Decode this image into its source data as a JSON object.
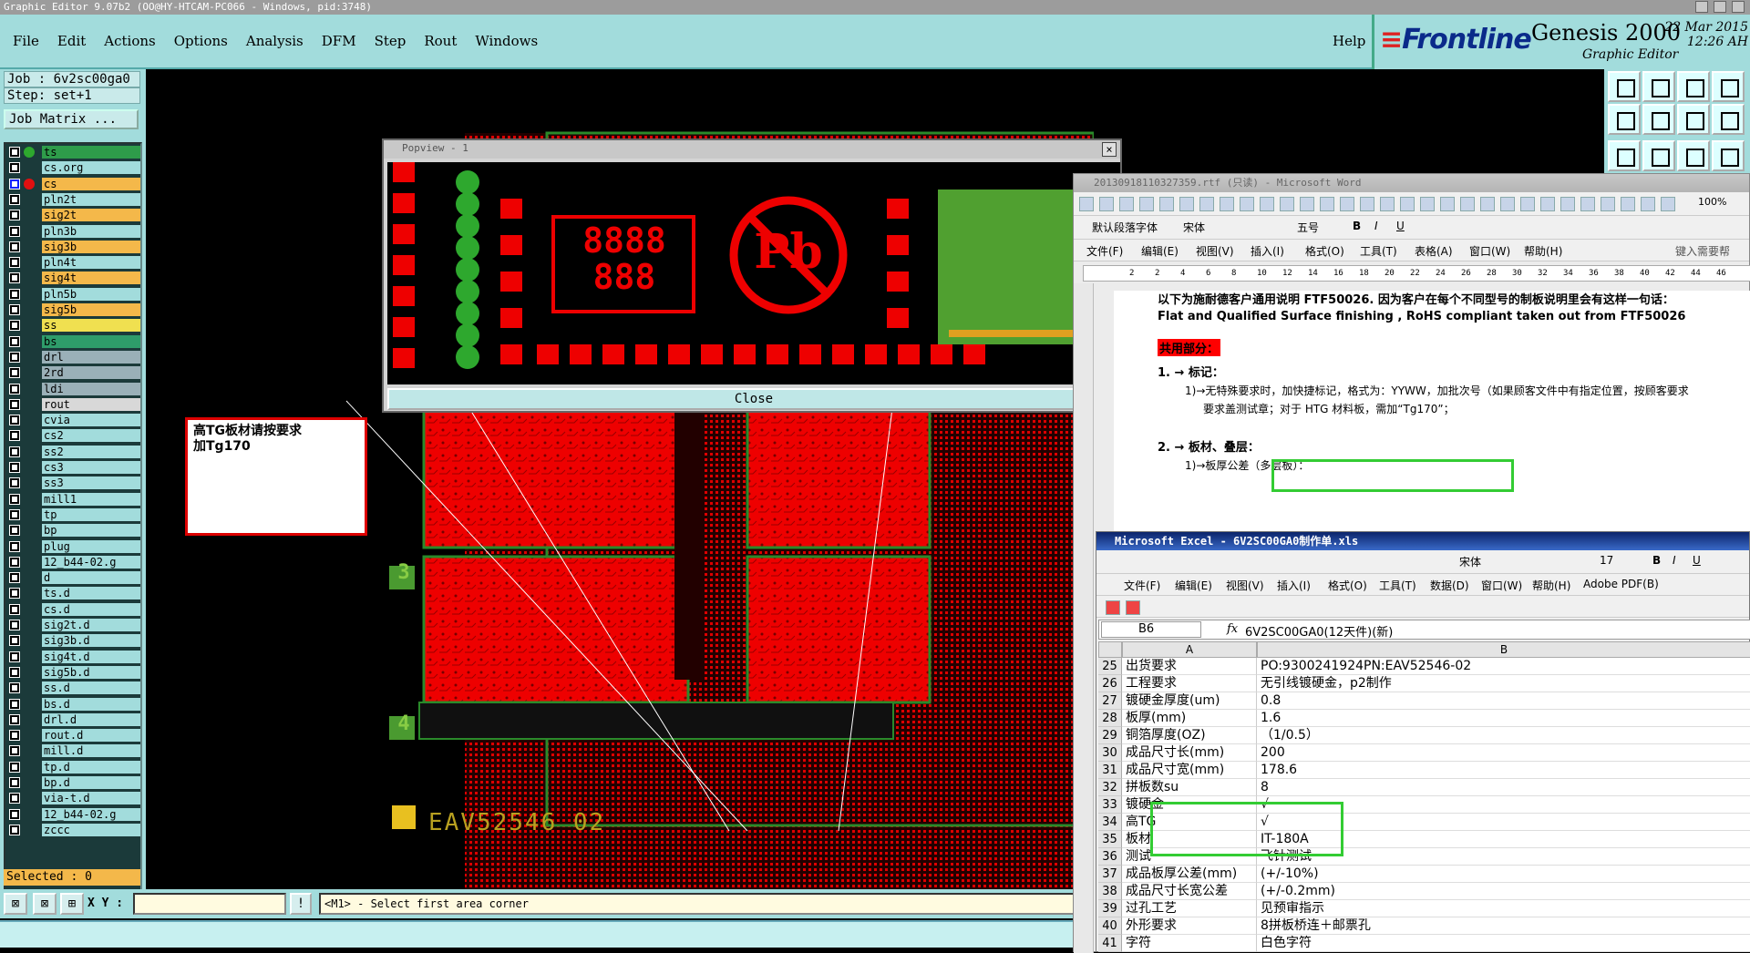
{
  "window": {
    "title": "Graphic Editor 9.07b2 (OO@HY-HTCAM-PC066 - Windows, pid:3748)"
  },
  "menu": {
    "items": [
      "File",
      "Edit",
      "Actions",
      "Options",
      "Analysis",
      "DFM",
      "Step",
      "Rout",
      "Windows"
    ],
    "help": "Help"
  },
  "brand": {
    "logo": "Frontline",
    "title": "Genesis 2000",
    "subtitle": "Graphic Editor",
    "date": "22 Mar 2015",
    "time": "12:26 AH"
  },
  "job": {
    "job_label": "Job : 6v2sc00ga0",
    "step_label": "Step: set+1",
    "matrix_button": "Job Matrix ..."
  },
  "layers": [
    {
      "name": "ts",
      "color": "#2e9c4a",
      "dot": "#2ea82e"
    },
    {
      "name": "cs.org",
      "color": "#a2dcdc",
      "dot": ""
    },
    {
      "name": "cs",
      "color": "#f4b84a",
      "dot": "#e01010",
      "active": true
    },
    {
      "name": "pln2t",
      "color": "#a2dcdc",
      "dot": ""
    },
    {
      "name": "sig2t",
      "color": "#f4b84a",
      "dot": ""
    },
    {
      "name": "pln3b",
      "color": "#a2dcdc",
      "dot": ""
    },
    {
      "name": "sig3b",
      "color": "#f4b84a",
      "dot": ""
    },
    {
      "name": "pln4t",
      "color": "#a2dcdc",
      "dot": ""
    },
    {
      "name": "sig4t",
      "color": "#f4b84a",
      "dot": ""
    },
    {
      "name": "pln5b",
      "color": "#a2dcdc",
      "dot": ""
    },
    {
      "name": "sig5b",
      "color": "#f4b84a",
      "dot": ""
    },
    {
      "name": "ss",
      "color": "#f0e050",
      "dot": ""
    },
    {
      "name": "bs",
      "color": "#2e9c6a",
      "dot": ""
    },
    {
      "name": "drl",
      "color": "#9ab0b8",
      "dot": ""
    },
    {
      "name": "2rd",
      "color": "#9ab0b8",
      "dot": ""
    },
    {
      "name": "ldi",
      "color": "#9ab0b8",
      "dot": ""
    },
    {
      "name": "rout",
      "color": "#d8d8d8",
      "dot": ""
    },
    {
      "name": "cvia",
      "color": "#a2dcdc",
      "dot": ""
    },
    {
      "name": "cs2",
      "color": "#a2dcdc",
      "dot": ""
    },
    {
      "name": "ss2",
      "color": "#a2dcdc",
      "dot": ""
    },
    {
      "name": "cs3",
      "color": "#a2dcdc",
      "dot": ""
    },
    {
      "name": "ss3",
      "color": "#a2dcdc",
      "dot": ""
    },
    {
      "name": "mill1",
      "color": "#a2dcdc",
      "dot": ""
    },
    {
      "name": "tp",
      "color": "#a2dcdc",
      "dot": ""
    },
    {
      "name": "bp",
      "color": "#a2dcdc",
      "dot": ""
    },
    {
      "name": "plug",
      "color": "#a2dcdc",
      "dot": ""
    },
    {
      "name": "12_b44-02.g",
      "color": "#a2dcdc",
      "dot": ""
    },
    {
      "name": "d",
      "color": "#a2dcdc",
      "dot": ""
    },
    {
      "name": "ts.d",
      "color": "#a2dcdc",
      "dot": ""
    },
    {
      "name": "cs.d",
      "color": "#a2dcdc",
      "dot": ""
    },
    {
      "name": "sig2t.d",
      "color": "#a2dcdc",
      "dot": ""
    },
    {
      "name": "sig3b.d",
      "color": "#a2dcdc",
      "dot": ""
    },
    {
      "name": "sig4t.d",
      "color": "#a2dcdc",
      "dot": ""
    },
    {
      "name": "sig5b.d",
      "color": "#a2dcdc",
      "dot": ""
    },
    {
      "name": "ss.d",
      "color": "#a2dcdc",
      "dot": ""
    },
    {
      "name": "bs.d",
      "color": "#a2dcdc",
      "dot": ""
    },
    {
      "name": "drl.d",
      "color": "#a2dcdc",
      "dot": ""
    },
    {
      "name": "rout.d",
      "color": "#a2dcdc",
      "dot": ""
    },
    {
      "name": "mill.d",
      "color": "#a2dcdc",
      "dot": ""
    },
    {
      "name": "tp.d",
      "color": "#a2dcdc",
      "dot": ""
    },
    {
      "name": "bp.d",
      "color": "#a2dcdc",
      "dot": ""
    },
    {
      "name": "via-t.d",
      "color": "#a2dcdc",
      "dot": ""
    },
    {
      "name": "12_b44-02.g",
      "color": "#a2dcdc",
      "dot": ""
    },
    {
      "name": "zccc",
      "color": "#a2dcdc",
      "dot": ""
    }
  ],
  "status": {
    "selected": "Selected : 0",
    "xy_label": "X Y :",
    "message": "<M1> - Select first area corner"
  },
  "popview": {
    "title": "Popview - 1",
    "close": "Close",
    "digits_top": "8888",
    "digits_bottom": "888",
    "pb": "Pb"
  },
  "canvas": {
    "label_3": "3",
    "label_4": "4",
    "part_number": "EAV52546 02"
  },
  "note": {
    "line1": "高TG板材请按要求",
    "line2": "加Tg170"
  },
  "word": {
    "title": "20130918110327359.rtf (只读) - Microsoft Word",
    "style": "默认段落字体",
    "font": "宋体",
    "size": "五号",
    "zoom": "100%",
    "menus": [
      "文件(F)",
      "编辑(E)",
      "视图(V)",
      "插入(I)",
      "格式(O)",
      "工具(T)",
      "表格(A)",
      "窗口(W)",
      "帮助(H)"
    ],
    "help_hint": "键入需要帮",
    "ruler": [
      "2",
      "2",
      "4",
      "6",
      "8",
      "10",
      "12",
      "14",
      "16",
      "18",
      "20",
      "22",
      "24",
      "26",
      "28",
      "30",
      "32",
      "34",
      "36",
      "38",
      "40",
      "42",
      "44",
      "46"
    ],
    "lines": [
      "以下为施耐德客户通用说明 FTF50026. 因为客户在每个不同型号的制板说明里会有这样一句话：",
      "Flat and Qualified Surface finishing , RoHS compliant taken out from FTF50026",
      "共用部分：",
      "1. → 标记：",
      "1)→无特殊要求时，加快捷标记，格式为：YYWW，加批次号（如果顾客文件中有指定位置，按顾客要求",
      "要求盖测试章；对于 HTG 材料板，需加“Tg170”；",
      "2. → 板材、叠层：",
      "1)→板厚公差（多层板）："
    ]
  },
  "excel": {
    "title": "Microsoft Excel - 6V2SC00GA0制作单.xls",
    "font": "宋体",
    "size": "17",
    "menus": [
      "文件(F)",
      "编辑(E)",
      "视图(V)",
      "插入(I)",
      "格式(O)",
      "工具(T)",
      "数据(D)",
      "窗口(W)",
      "帮助(H)",
      "Adobe PDF(B)"
    ],
    "namebox": "B6",
    "fx": "fx",
    "formula": "6V2SC00GA0(12天件)(新)",
    "col_a": "A",
    "col_b": "B",
    "rows": [
      {
        "n": "25",
        "a": "出货要求",
        "b": "PO:9300241924PN:EAV52546-02"
      },
      {
        "n": "26",
        "a": "工程要求",
        "b": "无引线镀硬金，p2制作"
      },
      {
        "n": "27",
        "a": "镀硬金厚度(um)",
        "b": "0.8"
      },
      {
        "n": "28",
        "a": "板厚(mm)",
        "b": "1.6"
      },
      {
        "n": "29",
        "a": "铜箔厚度(OZ)",
        "b": "（1/0.5）"
      },
      {
        "n": "30",
        "a": "成品尺寸长(mm)",
        "b": "200"
      },
      {
        "n": "31",
        "a": "成品尺寸宽(mm)",
        "b": "178.6"
      },
      {
        "n": "32",
        "a": "拼板数su",
        "b": "8"
      },
      {
        "n": "33",
        "a": "镀硬金",
        "b": "√"
      },
      {
        "n": "34",
        "a": "高TG",
        "b": "√"
      },
      {
        "n": "35",
        "a": "板材",
        "b": "IT-180A"
      },
      {
        "n": "36",
        "a": "测试",
        "b": "飞针测试"
      },
      {
        "n": "37",
        "a": "成品板厚公差(mm)",
        "b": "(+/-10%)"
      },
      {
        "n": "38",
        "a": "成品尺寸长宽公差",
        "b": "(+/-0.2mm)"
      },
      {
        "n": "39",
        "a": "过孔工艺",
        "b": "见预审指示"
      },
      {
        "n": "40",
        "a": "外形要求",
        "b": "8拼板桥连＋邮票孔"
      },
      {
        "n": "41",
        "a": "字符",
        "b": "白色字符"
      }
    ]
  }
}
